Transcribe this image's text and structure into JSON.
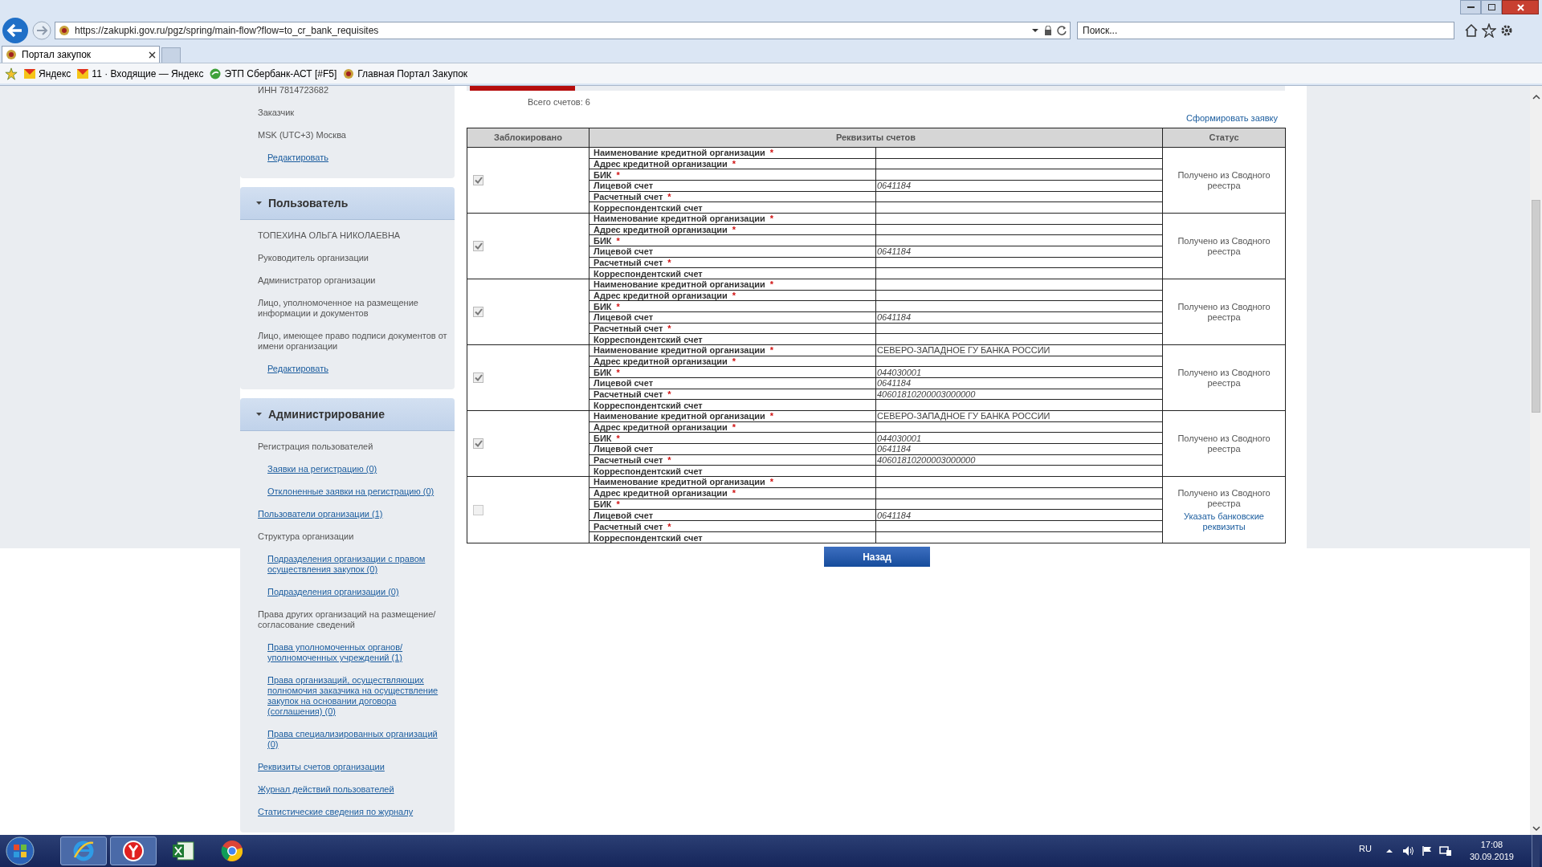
{
  "browser": {
    "url": "https://zakupki.gov.ru/pgz/spring/main-flow?flow=to_cr_bank_requisites",
    "search": {
      "placeholder": "Поиск..."
    },
    "tabs": [
      {
        "label": "Портал закупок",
        "selected": true
      }
    ],
    "favorites": [
      "Яндекс",
      "11 · Входящие — Яндекс",
      "ЭТП Сбербанк-АСТ [#F5]",
      "Главная Портал Закупок"
    ]
  },
  "sidebar": [
    {
      "items": [
        {
          "kind": "text",
          "text": "ИНН 7814723682"
        },
        {
          "kind": "text",
          "text": "Заказчик"
        },
        {
          "kind": "text",
          "text": "MSK (UTC+3) Москва"
        },
        {
          "kind": "sublink",
          "text": "Редактировать"
        }
      ]
    },
    {
      "title": "Пользователь",
      "expanded": true,
      "items": [
        {
          "kind": "text",
          "text": "ТОПЕХИНА ОЛЬГА НИКОЛАЕВНА"
        },
        {
          "kind": "text",
          "text": "Руководитель организации"
        },
        {
          "kind": "text",
          "text": "Администратор организации"
        },
        {
          "kind": "text",
          "text": "Лицо, уполномоченное на размещение информации и документов"
        },
        {
          "kind": "text",
          "text": "Лицо, имеющее право подписи документов от имени организации"
        },
        {
          "kind": "sublink",
          "text": "Редактировать"
        }
      ]
    },
    {
      "title": "Администрирование",
      "expanded": true,
      "items": [
        {
          "kind": "text",
          "text": "Регистрация пользователей"
        },
        {
          "kind": "sublink",
          "text": "Заявки на регистрацию (0)"
        },
        {
          "kind": "sublink",
          "text": "Отклоненные заявки на регистрацию (0)"
        },
        {
          "kind": "link",
          "text": "Пользователи организации (1)"
        },
        {
          "kind": "text",
          "text": "Структура организации"
        },
        {
          "kind": "sublink",
          "text": "Подразделения организации с правом осуществления закупок (0)"
        },
        {
          "kind": "sublink",
          "text": "Подразделения организации (0)"
        },
        {
          "kind": "text",
          "text": "Права других организаций на размещение/согласование сведений"
        },
        {
          "kind": "sublink",
          "text": "Права уполномоченных органов/ уполномоченных учреждений (1)"
        },
        {
          "kind": "sublink",
          "text": "Права организаций, осуществляющих полномочия заказчика на осуществление закупок на основании договора (соглашения) (0)"
        },
        {
          "kind": "sublink",
          "text": "Права специализированных организаций (0)"
        },
        {
          "kind": "link",
          "text": "Реквизиты счетов организации"
        },
        {
          "kind": "link",
          "text": "Журнал действий пользователей"
        },
        {
          "kind": "link",
          "text": "Статистические сведения по журналу"
        }
      ]
    }
  ],
  "main": {
    "total": "Всего счетов: 6",
    "form_link": "Сформировать заявку",
    "table": {
      "columns": [
        "Заблокировано",
        "Реквизиты счетов",
        "Статус"
      ],
      "rows": [
        {
          "blocked": true,
          "status": "Получено из Сводного реестра",
          "fields": [
            {
              "label": "Наименование кредитной организации",
              "mark": "*"
            },
            {
              "label": "Адрес кредитной организации",
              "mark": "*"
            },
            {
              "label": "БИК",
              "mark": "*"
            },
            {
              "label": "Лицевой счет",
              "value": "0641184"
            },
            {
              "label": "Расчетный счет",
              "mark": "*"
            },
            {
              "label": "Корреспондентский счет"
            }
          ]
        },
        {
          "blocked": true,
          "status": "Получено из Сводного реестра",
          "fields": [
            {
              "label": "Наименование кредитной организации",
              "mark": "*"
            },
            {
              "label": "Адрес кредитной организации",
              "mark": "*"
            },
            {
              "label": "БИК",
              "mark": "*"
            },
            {
              "label": "Лицевой счет",
              "value": "0641184"
            },
            {
              "label": "Расчетный счет",
              "mark": "*"
            },
            {
              "label": "Корреспондентский счет"
            }
          ]
        },
        {
          "blocked": true,
          "status": "Получено из Сводного реестра",
          "fields": [
            {
              "label": "Наименование кредитной организации",
              "mark": "*"
            },
            {
              "label": "Адрес кредитной организации",
              "mark": "*"
            },
            {
              "label": "БИК",
              "mark": "*"
            },
            {
              "label": "Лицевой счет",
              "value": "0641184"
            },
            {
              "label": "Расчетный счет",
              "mark": "*"
            },
            {
              "label": "Корреспондентский счет"
            }
          ]
        },
        {
          "blocked": true,
          "status": "Получено из Сводного реестра",
          "fields": [
            {
              "label": "Наименование кредитной организации",
              "mark": "*",
              "value": "СЕВЕРО-ЗАПАДНОЕ ГУ БАНКА РОССИИ"
            },
            {
              "label": "Адрес кредитной организации",
              "mark": "*"
            },
            {
              "label": "БИК",
              "mark": "*",
              "value": "044030001"
            },
            {
              "label": "Лицевой счет",
              "value": "0641184"
            },
            {
              "label": "Расчетный счет",
              "mark": "*",
              "value": "40601810200003000000"
            },
            {
              "label": "Корреспондентский счет"
            }
          ]
        },
        {
          "blocked": true,
          "status": "Получено из Сводного реестра",
          "fields": [
            {
              "label": "Наименование кредитной организации",
              "mark": "*",
              "value": "СЕВЕРО-ЗАПАДНОЕ ГУ БАНКА РОССИИ"
            },
            {
              "label": "Адрес кредитной организации",
              "mark": "*"
            },
            {
              "label": "БИК",
              "mark": "*",
              "value": "044030001"
            },
            {
              "label": "Лицевой счет",
              "value": "0641184"
            },
            {
              "label": "Расчетный счет",
              "mark": "*",
              "value": "40601810200003000000"
            },
            {
              "label": "Корреспондентский счет"
            }
          ]
        },
        {
          "blocked": false,
          "status": "Получено из Сводного реестра",
          "action": "Указать банковские реквизиты",
          "fields": [
            {
              "label": "Наименование кредитной организации",
              "mark": "*"
            },
            {
              "label": "Адрес кредитной организации",
              "mark": "*"
            },
            {
              "label": "БИК",
              "mark": "*"
            },
            {
              "label": "Лицевой счет",
              "value": "0641184"
            },
            {
              "label": "Расчетный счет",
              "mark": "*"
            },
            {
              "label": "Корреспондентский счет"
            }
          ]
        }
      ]
    },
    "back_button": "Назад"
  },
  "taskbar": {
    "language": "RU",
    "time": "17:08",
    "date": "30.09.2019"
  }
}
